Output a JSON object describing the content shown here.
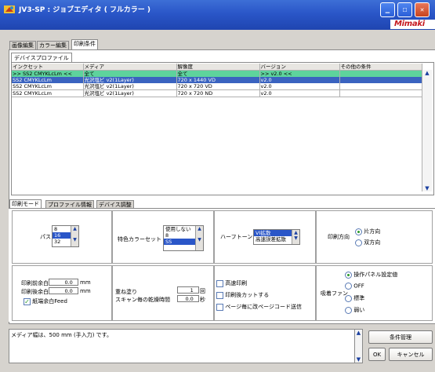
{
  "window": {
    "title": "JV3-SP : ジョブエディタ ( フルカラー )",
    "logo": "Mimaki"
  },
  "tabs": [
    {
      "label": "画像編集"
    },
    {
      "label": "カラー編集"
    },
    {
      "label": "印刷条件"
    }
  ],
  "device_tab": {
    "label": "デバイスプロファイル"
  },
  "table": {
    "headers": [
      "インクセット",
      "メディア",
      "解像度",
      "バージョン",
      "その他の条件"
    ],
    "rows": [
      [
        ">> SS2 CMYKLcLm <<",
        "全て",
        "全て",
        ">> v2.0 <<",
        ""
      ],
      [
        "SS2 CMYKLcLm",
        "光沢塩ビ v2(1Layer)",
        "720 x 1440 VD",
        "v2.0",
        ""
      ],
      [
        "SS2 CMYKLcLm",
        "光沢塩ビ v2(1Layer)",
        "720 x 720 VD",
        "v2.0",
        ""
      ],
      [
        "SS2 CMYKLcLm",
        "光沢塩ビ v2(1Layer)",
        "720 x 720 ND",
        "v2.0",
        ""
      ]
    ]
  },
  "lower_tabs": [
    {
      "label": "印刷モード"
    },
    {
      "label": "プロファイル情報"
    },
    {
      "label": "デバイス調整"
    }
  ],
  "pass": {
    "label": "パス",
    "options": [
      "8",
      "16",
      "32"
    ],
    "selected": "16"
  },
  "special_color": {
    "label": "特色カラーセット",
    "options": [
      "使用しない",
      "8",
      "SS"
    ],
    "selected": "SS"
  },
  "halftone": {
    "label": "ハーフトーン",
    "options": [
      "VI拡散",
      "高速誤差拡散"
    ],
    "selected": "VI拡散"
  },
  "direction": {
    "label": "印刷方向",
    "options": [
      "片方向",
      "双方向"
    ],
    "selected": "片方向"
  },
  "margins": {
    "front_label": "印刷前余白",
    "front_value": "0.0",
    "unit": "mm",
    "back_label": "印刷後余白",
    "back_value": "0.0",
    "feed_label": "紙端余白Feed",
    "feed_checked": true
  },
  "overprint": {
    "label": "重ね塗り",
    "value": "1",
    "unit": "回",
    "dry_label": "スキャン毎の乾燥時間",
    "dry_value": "0.0",
    "dry_unit": "秒"
  },
  "checks": {
    "items": [
      "高速印刷",
      "印刷後カットする",
      "ページ毎に改ページコード送信"
    ]
  },
  "fan": {
    "label": "吸着ファン",
    "options": [
      "操作パネル設定値",
      "OFF",
      "標準",
      "弱い"
    ],
    "selected": "操作パネル設定値"
  },
  "status": {
    "text": "メディア幅は、500 mm (手入力) です。"
  },
  "buttons": {
    "condition": "条件管理",
    "ok": "OK",
    "cancel": "キャンセル"
  },
  "colors": {
    "title_bar": "#2a56c8",
    "highlight_green": "#5ed39c",
    "highlight_blue": "#3a63c0",
    "close": "#c8441f"
  }
}
